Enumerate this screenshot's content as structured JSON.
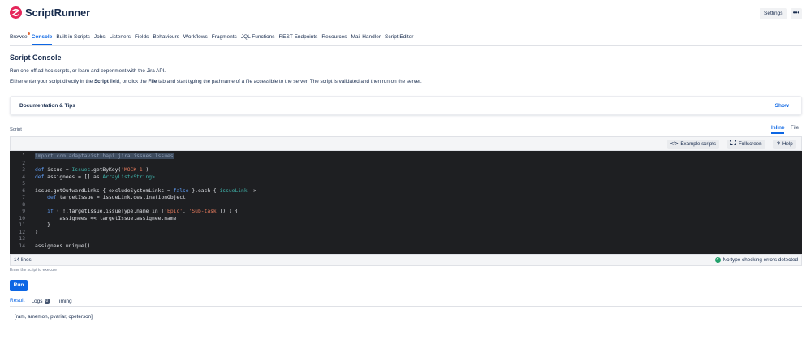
{
  "app": {
    "name": "ScriptRunner"
  },
  "header": {
    "settings_label": "Settings",
    "more_label": "•••"
  },
  "nav": {
    "tabs": [
      {
        "label": "Browse",
        "active": false,
        "notification": true
      },
      {
        "label": "Console",
        "active": true
      },
      {
        "label": "Built-in Scripts",
        "active": false
      },
      {
        "label": "Jobs",
        "active": false
      },
      {
        "label": "Listeners",
        "active": false
      },
      {
        "label": "Fields",
        "active": false
      },
      {
        "label": "Behaviours",
        "active": false
      },
      {
        "label": "Workflows",
        "active": false
      },
      {
        "label": "Fragments",
        "active": false
      },
      {
        "label": "JQL Functions",
        "active": false
      },
      {
        "label": "REST Endpoints",
        "active": false
      },
      {
        "label": "Resources",
        "active": false
      },
      {
        "label": "Mail Handler",
        "active": false
      },
      {
        "label": "Script Editor",
        "active": false
      }
    ]
  },
  "page": {
    "title": "Script Console",
    "description": "Run one-off ad hoc scripts, or learn and experiment with the Jira API.",
    "instructions": {
      "pre": "Either enter your script directly in the ",
      "script_word": "Script",
      "mid": " field, or click the ",
      "file_word": "File",
      "post": " tab and start typing the pathname of a file accessible to the server. The script is validated and then run on the server."
    }
  },
  "docs_panel": {
    "title": "Documentation & Tips",
    "show_label": "Show"
  },
  "script": {
    "label": "Script",
    "mode_tabs": {
      "inline": "Inline",
      "file": "File"
    },
    "toolbar": {
      "examples": "Example scripts",
      "fullscreen": "Fullscreen",
      "help": "Help"
    },
    "lines": [
      [
        {
          "t": "import com.adaptavist.hapi.jira.issues.Issues",
          "c": "sel"
        }
      ],
      [],
      [
        {
          "t": "def",
          "c": "kw"
        },
        {
          "t": " issue = "
        },
        {
          "t": "Issues",
          "c": "cls"
        },
        {
          "t": ".getByKey("
        },
        {
          "t": "'MOCK-1'",
          "c": "str"
        },
        {
          "t": ")"
        }
      ],
      [
        {
          "t": "def",
          "c": "kw"
        },
        {
          "t": " assignees = [] as "
        },
        {
          "t": "ArrayList<String>",
          "c": "cls"
        }
      ],
      [],
      [
        {
          "t": "issue.getOutwardLinks { excludeSystemLinks = "
        },
        {
          "t": "false",
          "c": "kw"
        },
        {
          "t": " }.each { "
        },
        {
          "t": "issueLink",
          "c": "cls"
        },
        {
          "t": " ->"
        }
      ],
      [
        {
          "t": "    "
        },
        {
          "t": "def",
          "c": "kw"
        },
        {
          "t": " targetIssue = issueLink.destinationObject"
        }
      ],
      [],
      [
        {
          "t": "    "
        },
        {
          "t": "if",
          "c": "kw"
        },
        {
          "t": " ( !(targetIssue.issueType.name in ["
        },
        {
          "t": "'Epic'",
          "c": "str"
        },
        {
          "t": ", "
        },
        {
          "t": "'Sub-task'",
          "c": "str"
        },
        {
          "t": "]) ) {"
        }
      ],
      [
        {
          "t": "        assignees << targetIssue.assignee.name"
        }
      ],
      [
        {
          "t": "    }"
        }
      ],
      [
        {
          "t": "}"
        }
      ],
      [],
      [
        {
          "t": "assignees.unique()"
        }
      ]
    ],
    "line_count": "14 lines",
    "validation": "No type checking errors detected",
    "hint": "Enter the script to execute"
  },
  "run_label": "Run",
  "results": {
    "tabs": [
      {
        "label": "Result",
        "active": true
      },
      {
        "label": "Logs",
        "badge": "0",
        "active": false
      },
      {
        "label": "Timing",
        "active": false
      }
    ],
    "output": "[ram, amemon, pvariar, cpeterson]"
  }
}
